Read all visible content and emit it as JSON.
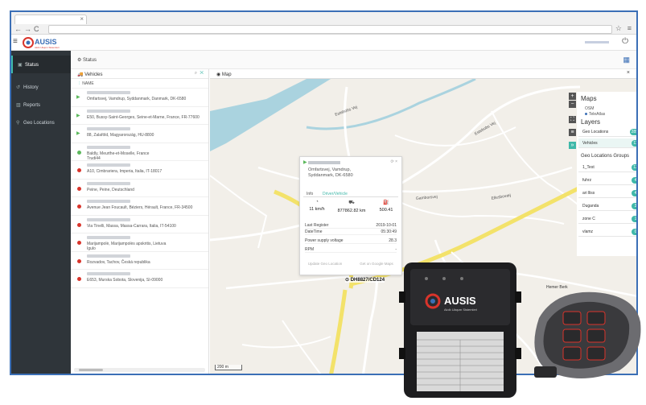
{
  "browser": {
    "nav_back": "←",
    "nav_forward": "→",
    "nav_reload": "C"
  },
  "header": {
    "logo_brand": "AUSIS",
    "logo_tagline": "Akıllı Ulaşım Sistemleri"
  },
  "sidebar": {
    "items": [
      {
        "label": "Status",
        "icon": "status-icon"
      },
      {
        "label": "History",
        "icon": "history-icon"
      },
      {
        "label": "Reports",
        "icon": "reports-icon"
      },
      {
        "label": "Geo Locations",
        "icon": "geo-icon"
      }
    ]
  },
  "status_bar": {
    "label": "Status"
  },
  "vehicles_panel": {
    "title": "Vehicles",
    "column": "NAME",
    "items": [
      {
        "status": "moving",
        "address": "Omfartsvej, Vamdrup, Syddanmark, Danmark, DK-6580",
        "extra": ""
      },
      {
        "status": "moving",
        "address": "E50, Bussy-Saint-Georges, Seine-et-Marne, France, FR-77600",
        "extra": ""
      },
      {
        "status": "moving",
        "address": "88, Zalaföld, Magyarország, HU-8800",
        "extra": ""
      },
      {
        "status": "idle",
        "address": "Baldly, Meurthe-et-Moselle, France",
        "extra": "Trudi44"
      },
      {
        "status": "stopped",
        "address": "A10, Cimbrariera, Imperia, Italia, IT-18017",
        "extra": ""
      },
      {
        "status": "stopped",
        "address": "Peine, Peine, Deutschland",
        "extra": ""
      },
      {
        "status": "stopped",
        "address": "Avenue Jean Foucault, Béziers, Hérault, France, FR-34500",
        "extra": ""
      },
      {
        "status": "stopped",
        "address": "Via Tinelli, Massa, Massa-Carrara, Italia, IT-54100",
        "extra": ""
      },
      {
        "status": "stopped",
        "address": "Marijampolė, Marijampolės apskritis, Lietuva",
        "extra": "Igulo"
      },
      {
        "status": "stopped",
        "address": "Rozvadov, Tachov, Česká republika",
        "extra": ""
      },
      {
        "status": "stopped",
        "address": "E653, Murska Sobota, Slovenija, SI-09000",
        "extra": ""
      }
    ]
  },
  "map_panel": {
    "title": "Map",
    "scale": "200 m",
    "vehicle_label": "DH8827/CD124",
    "place_label": "Hemer Berk",
    "road_labels": [
      "Estebobs Vej",
      "Gamborsvej",
      "Ellesbovæj",
      "Estebobs Vej"
    ]
  },
  "popup": {
    "address": "Omfartsvej, Vamdrup, Syddanmark, DK-6580",
    "tabs": [
      "Info",
      "Driver/Vehicle"
    ],
    "metrics": [
      {
        "icon": "speed-icon",
        "value": "11 km/h"
      },
      {
        "icon": "odometer-icon",
        "value": "877862.82 km"
      },
      {
        "icon": "fuel-icon",
        "value": "500.41"
      }
    ],
    "rows": [
      {
        "label": "Last Register",
        "value": "2019-10-01"
      },
      {
        "label": "DateTime",
        "value": "05:30:49"
      },
      {
        "label": "Power supply voltage",
        "value": "28.3"
      },
      {
        "label": "RPM",
        "value": "-"
      }
    ],
    "links": [
      "Update Geo Location",
      "Get on Google Maps"
    ]
  },
  "layers": {
    "maps_title": "Maps",
    "map_options": [
      "OSM",
      "TeleAtlas"
    ],
    "layers_title": "Layers",
    "layer_items": [
      {
        "label": "Geo Locations",
        "count": "285"
      },
      {
        "label": "Vehicles",
        "count": "11"
      }
    ],
    "groups_title": "Geo Locations Groups",
    "group_items": [
      {
        "label": "1_Test",
        "count": "12"
      },
      {
        "label": "fuhrz",
        "count": "4"
      },
      {
        "label": "ari lliss",
        "count": "4"
      },
      {
        "label": "Duganda",
        "count": "3"
      },
      {
        "label": "zone C",
        "count": "1"
      },
      {
        "label": "vlamz",
        "count": "0"
      }
    ]
  },
  "colors": {
    "accent": "#3fb8a9",
    "brand_blue": "#3b6fb6",
    "sidebar": "#2f353a",
    "road_yellow": "#f3e26a"
  }
}
